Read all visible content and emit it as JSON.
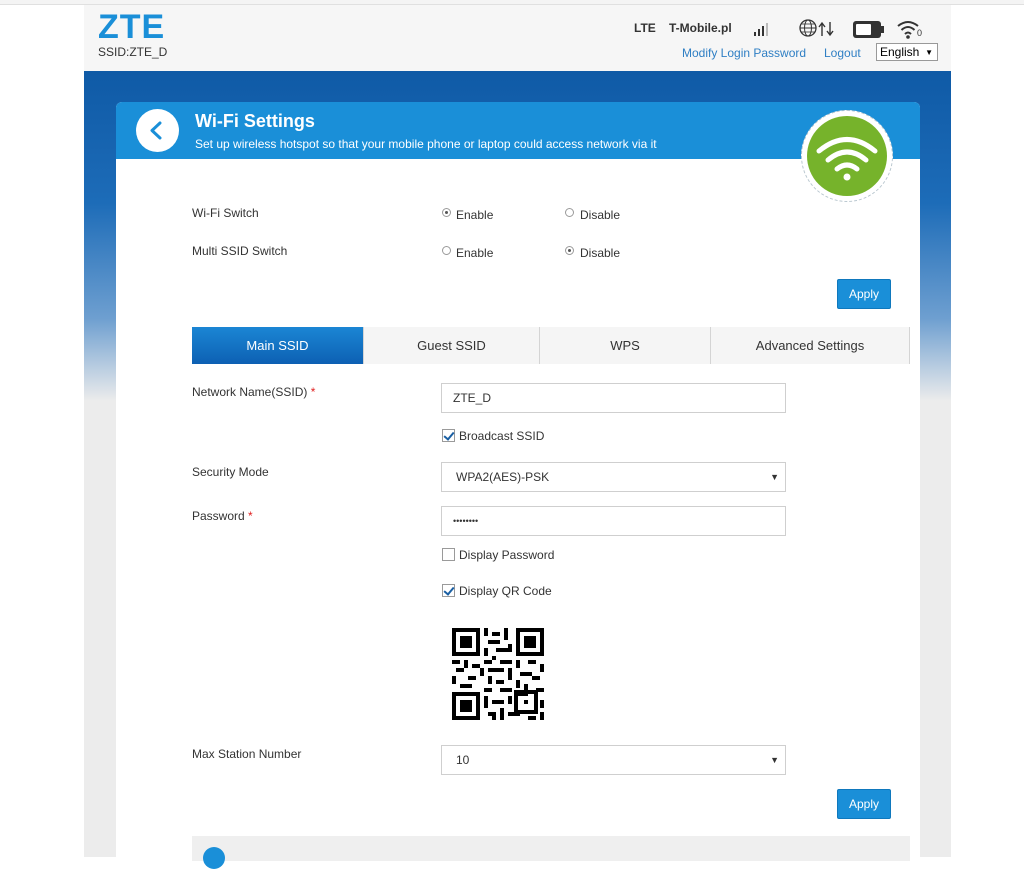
{
  "header": {
    "logo": "ZTE",
    "ssid": "SSID:ZTE_D",
    "network_type": "LTE",
    "operator": "T-Mobile.pl",
    "modify_password": "Modify Login Password",
    "logout": "Logout",
    "language": "English",
    "icons": [
      "signal-bars-icon",
      "globe-data-icon",
      "battery-icon",
      "wifi-clients-icon"
    ],
    "wifi_clients_count": "0"
  },
  "panel": {
    "title": "Wi-Fi Settings",
    "subtitle": "Set up wireless hotspot so that your mobile phone or laptop could access network via it",
    "accent_color": "#1a8fd8",
    "badge_color": "#76b32b"
  },
  "switches": {
    "wifi_switch": {
      "label": "Wi-Fi Switch",
      "enable": "Enable",
      "disable": "Disable",
      "selected": "Enable"
    },
    "multi_ssid": {
      "label": "Multi SSID Switch",
      "enable": "Enable",
      "disable": "Disable",
      "selected": "Disable"
    },
    "apply": "Apply"
  },
  "tabs": [
    "Main SSID",
    "Guest SSID",
    "WPS",
    "Advanced Settings"
  ],
  "active_tab": "Main SSID",
  "form": {
    "ssid_label": "Network Name(SSID)",
    "required_mark": "*",
    "ssid_value": "ZTE_D",
    "broadcast_ssid": "Broadcast SSID",
    "broadcast_checked": true,
    "security_label": "Security Mode",
    "security_value": "WPA2(AES)-PSK",
    "password_label": "Password",
    "password_value": "••••••••",
    "display_password": "Display Password",
    "display_password_checked": false,
    "display_qr": "Display QR Code",
    "display_qr_checked": true,
    "max_station_label": "Max Station Number",
    "max_station_value": "10",
    "apply": "Apply"
  }
}
